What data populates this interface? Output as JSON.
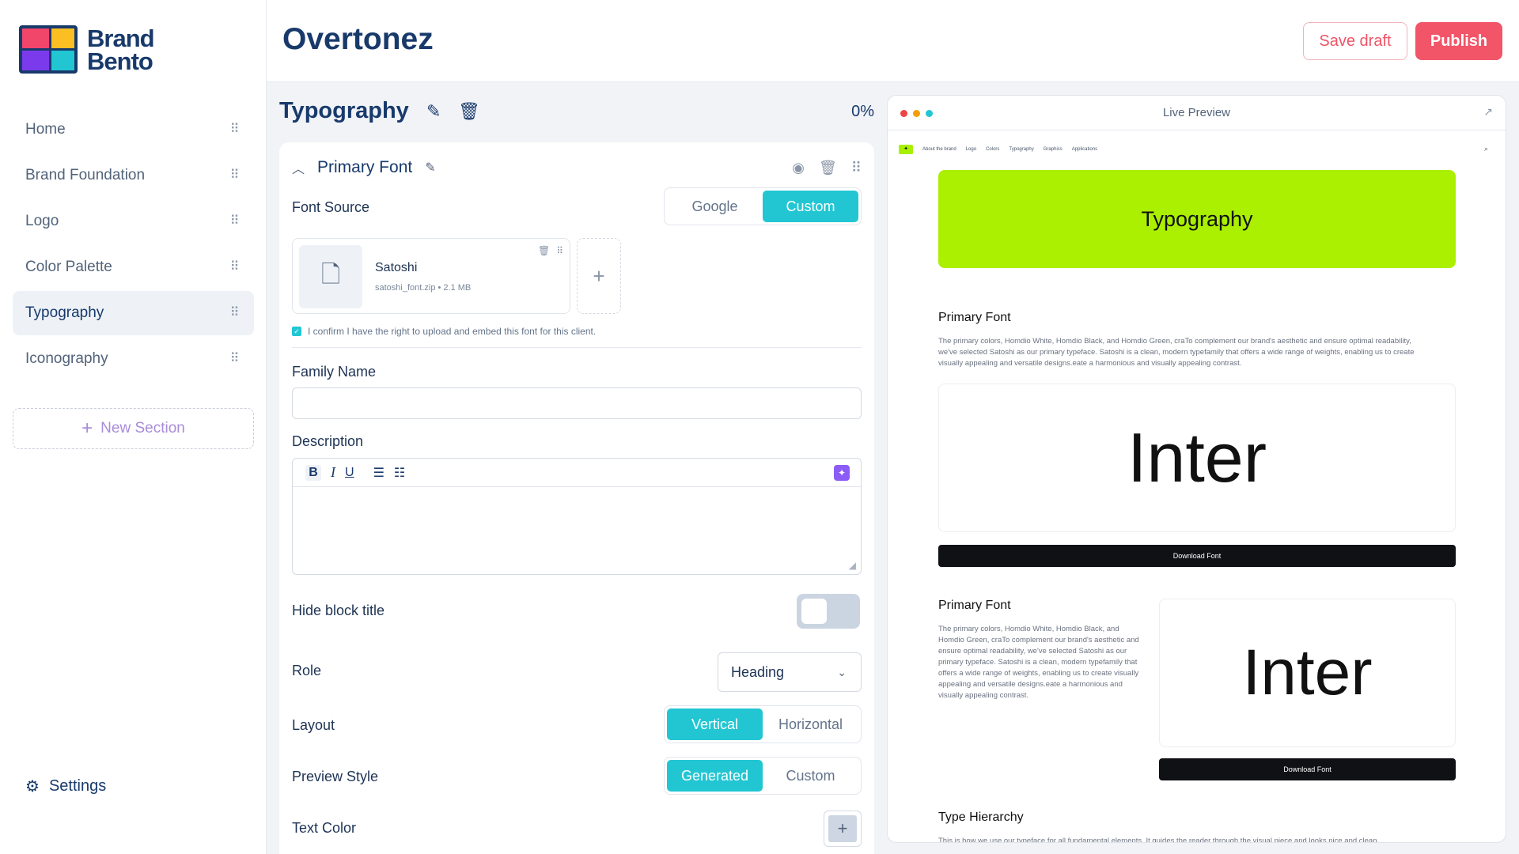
{
  "brand": {
    "line1": "Brand",
    "line2": "Bento",
    "colors": {
      "pink": "#f2456a",
      "yellow": "#fbbf24",
      "purple": "#7c3aed",
      "cyan": "#22c6d3",
      "navy": "#183a6b"
    }
  },
  "sidebar": {
    "items": [
      {
        "label": "Home",
        "active": false
      },
      {
        "label": "Brand Foundation",
        "active": false
      },
      {
        "label": "Logo",
        "active": false
      },
      {
        "label": "Color Palette",
        "active": false
      },
      {
        "label": "Typography",
        "active": true
      },
      {
        "label": "Iconography",
        "active": false
      }
    ],
    "new_section": "New Section",
    "settings": "Settings"
  },
  "header": {
    "project": "Overtonez",
    "save_draft": "Save draft",
    "publish": "Publish"
  },
  "editor": {
    "section_title": "Typography",
    "progress": "0%",
    "block_title": "Primary Font",
    "font_source": {
      "label": "Font Source",
      "options": [
        "Google",
        "Custom"
      ],
      "selected": "Custom"
    },
    "file": {
      "name": "Satoshi",
      "meta": "satoshi_font.zip • 2.1 MB"
    },
    "confirm": "I confirm I have the right to upload and embed this font for this client.",
    "family_name": {
      "label": "Family Name",
      "value": ""
    },
    "description": {
      "label": "Description",
      "value": ""
    },
    "hide_title": {
      "label": "Hide block title",
      "on": false
    },
    "role": {
      "label": "Role",
      "value": "Heading"
    },
    "layout": {
      "label": "Layout",
      "options": [
        "Vertical",
        "Horizontal"
      ],
      "selected": "Vertical"
    },
    "preview_style": {
      "label": "Preview Style",
      "options": [
        "Generated",
        "Custom"
      ],
      "selected": "Generated"
    },
    "text_color": {
      "label": "Text Color"
    }
  },
  "preview": {
    "title": "Live Preview",
    "nav": [
      "About the brand",
      "Logo",
      "Colors",
      "Typography",
      "Graphics",
      "Applications"
    ],
    "hero": "Typography",
    "hero_color": "#aaf000",
    "block1": {
      "heading": "Primary Font",
      "body": "The primary colors, Homdio White, Homdio Black, and Homdio Green, craTo complement our brand's aesthetic and ensure optimal readability, we've selected Satoshi as our primary typeface. Satoshi is a clean, modern typefamily that offers a wide range of weights, enabling us to create visually appealing and versatile designs.eate a harmonious and visually appealing contrast.",
      "specimen": "Inter",
      "download": "Download Font"
    },
    "block2": {
      "heading": "Primary Font",
      "body": "The primary colors, Homdio White, Homdio Black, and Homdio Green, craTo complement our brand's aesthetic and ensure optimal readability, we've selected Satoshi as our primary typeface. Satoshi is a clean, modern typefamily that offers a wide range of weights, enabling us to create visually appealing and versatile designs.eate a harmonious and visually appealing contrast.",
      "specimen": "Inter",
      "download": "Download Font"
    },
    "block3": {
      "heading": "Type Hierarchy",
      "body": "This is how we use our typeface for all fundamental elements. It guides the reader through the visual piece and looks nice and clean."
    }
  }
}
